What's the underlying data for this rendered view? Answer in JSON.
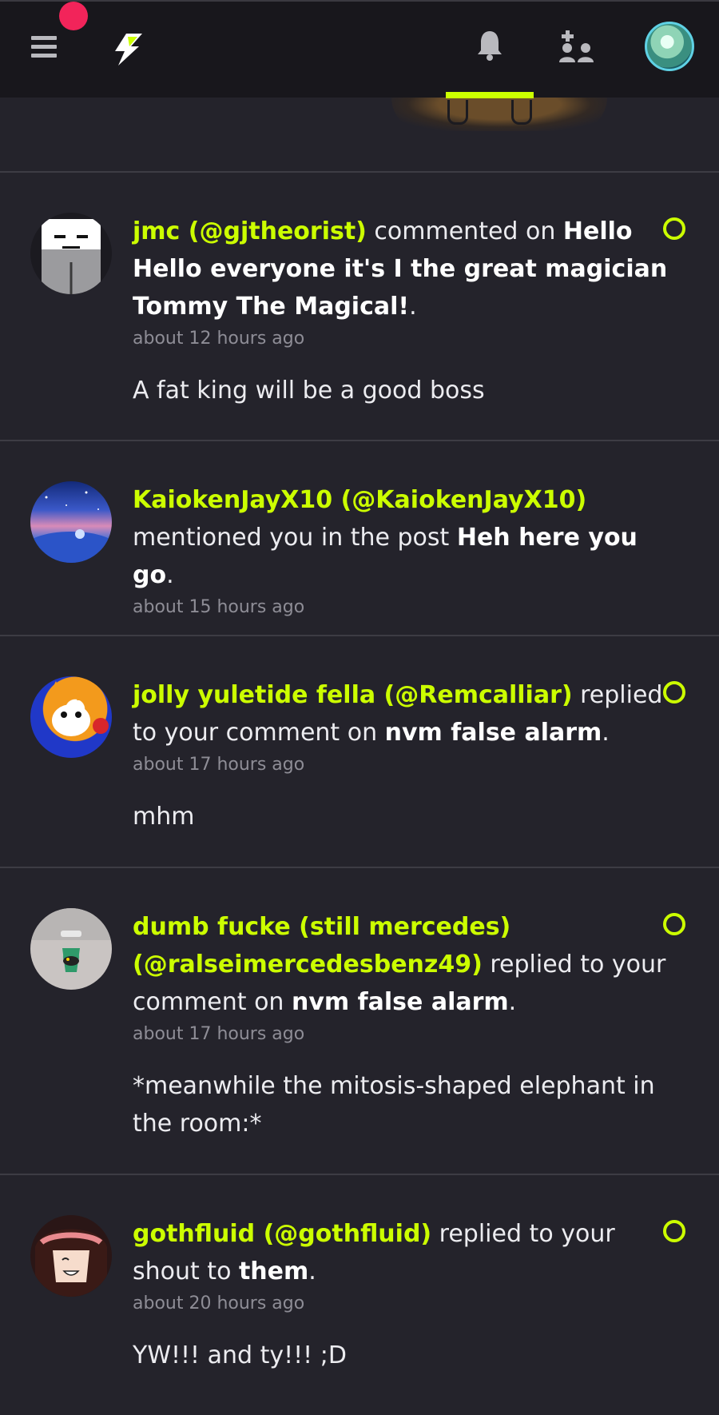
{
  "nav": {
    "menu_icon": "hamburger-icon",
    "logo_icon": "lightning-logo-icon",
    "notifications_icon": "bell-icon",
    "friends_icon": "friends-icon",
    "accent_color": "#ccff00",
    "badge_color": "#f2245a"
  },
  "notifications": [
    {
      "username": "jmc (@gjtheorist)",
      "action": " commented on ",
      "target": "Hello Hello everyone it's I the great magician Tommy The Magical!",
      "tail": ".",
      "time": "about 12 hours ago",
      "body": "A fat king will be a good boss",
      "unread": true
    },
    {
      "username": "KaiokenJayX10 (@KaiokenJayX10)",
      "action": " mentioned you in the post ",
      "target": "Heh here you go",
      "tail": ".",
      "time": "about 15 hours ago",
      "body": "",
      "unread": false
    },
    {
      "username": "jolly yuletide fella (@Remcalliar)",
      "action": " replied to your comment on ",
      "target": "nvm false alarm",
      "tail": ".",
      "time": "about 17 hours ago",
      "body": "mhm",
      "unread": true
    },
    {
      "username": "dumb fucke (still mercedes) (@ralseimercedesbenz49)",
      "action": " replied to your comment on ",
      "target": "nvm false alarm",
      "tail": ".",
      "time": "about 17 hours ago",
      "body": "*meanwhile the mitosis-shaped elephant in the room:*",
      "unread": true
    },
    {
      "username": "gothfluid (@gothfluid)",
      "action": " replied to your shout to ",
      "target": "them",
      "tail": ".",
      "time": "about 20 hours ago",
      "body": "YW!!! and ty!!! ;D",
      "unread": true
    }
  ]
}
